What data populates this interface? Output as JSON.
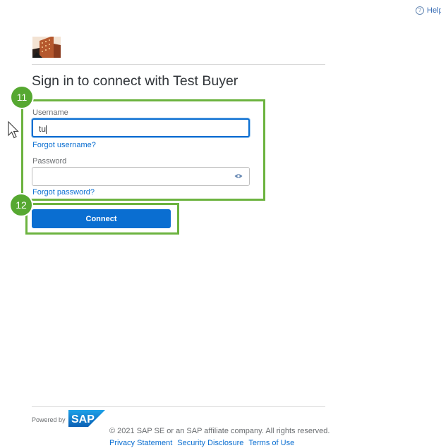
{
  "header": {
    "help_label": "Help"
  },
  "page": {
    "title": "Sign in to connect with Test Buyer"
  },
  "form": {
    "username_label": "Username",
    "username_value": "tu",
    "forgot_username": "Forgot username?",
    "password_label": "Password",
    "password_value": "",
    "forgot_password": "Forgot password?",
    "connect_label": "Connect"
  },
  "annotations": {
    "step_11": "11",
    "step_12": "12"
  },
  "footer": {
    "powered_by": "Powered by",
    "brand": "SAP",
    "copyright": "© 2021 SAP SE or an SAP affiliate company. All rights reserved.",
    "links": [
      "Privacy Statement",
      "Security Disclosure",
      "Terms of Use"
    ]
  },
  "colors": {
    "accent": "#0a6ed1",
    "annotation_green": "#56a831",
    "help_link": "#3b6fb6"
  },
  "icons": [
    "help-circle-icon",
    "building-logo",
    "eye-icon",
    "mouse-cursor-icon",
    "sap-logo"
  ]
}
